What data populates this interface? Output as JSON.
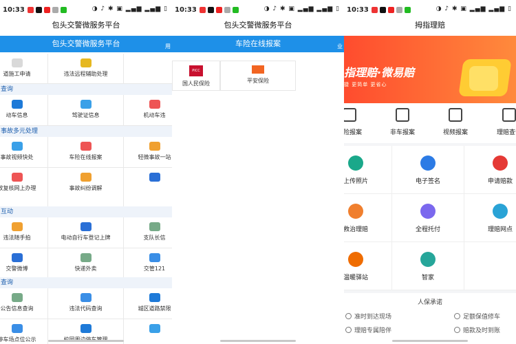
{
  "statusbar": {
    "time": "10:33",
    "right": "◑ ♪ ✱ ▣ ▂▄▆ ▂▄▆ ▯"
  },
  "panel1": {
    "title": "包头交警微服务平台",
    "bar": "包头交警微服务平台",
    "bar_side": "用",
    "sections": [
      "查询",
      "事故多元处理",
      "互动",
      "查询"
    ],
    "row0": [
      "道施工申请",
      "违法远程辅助处理",
      ""
    ],
    "cells": [
      [
        "动车信息",
        "驾驶证信息",
        "机动车违"
      ],
      [
        "事故视频快处",
        "车险在线报案",
        "轻微事故一站"
      ],
      [
        "故复核网上办理",
        "事故纠纷调解",
        ""
      ],
      [
        "违法随手拍",
        "电动自行车登记上牌",
        "支队长信"
      ],
      [
        "交警微博",
        "快递外卖",
        "交管121"
      ],
      [
        "公告信息查询",
        "违法代码查询",
        "城区道路禁限"
      ],
      [
        "停车场点位公示",
        "校园周边停车管理",
        ""
      ]
    ]
  },
  "panel2": {
    "title": "包头交警微服务平台",
    "bar": "车险在线报案",
    "bar_side": "业",
    "insurers": [
      {
        "name": "国人民保险",
        "logo": "PICC"
      },
      {
        "name": "平安保险",
        "logo": ""
      }
    ]
  },
  "panel3": {
    "title": "拇指理赔",
    "banner_title": "指理赔·微易赔",
    "banner_sub": "捷  更简单  更省心",
    "tabs": [
      "车险报案",
      "非车报案",
      "视频报案",
      "理赔查询"
    ],
    "grid": [
      "上传照片",
      "电子签名",
      "申请赔款",
      "救治理赔",
      "全程托付",
      "理赔网点",
      "温暖驿站",
      "智家",
      ""
    ],
    "promise_title": "人保承诺",
    "promises": [
      "准时到达现场",
      "足额保值修车",
      "理赔专属陪伴",
      "赔款及时到账"
    ]
  },
  "colors": {
    "blue": "#1e90e8",
    "orange": "#ff5a30"
  }
}
